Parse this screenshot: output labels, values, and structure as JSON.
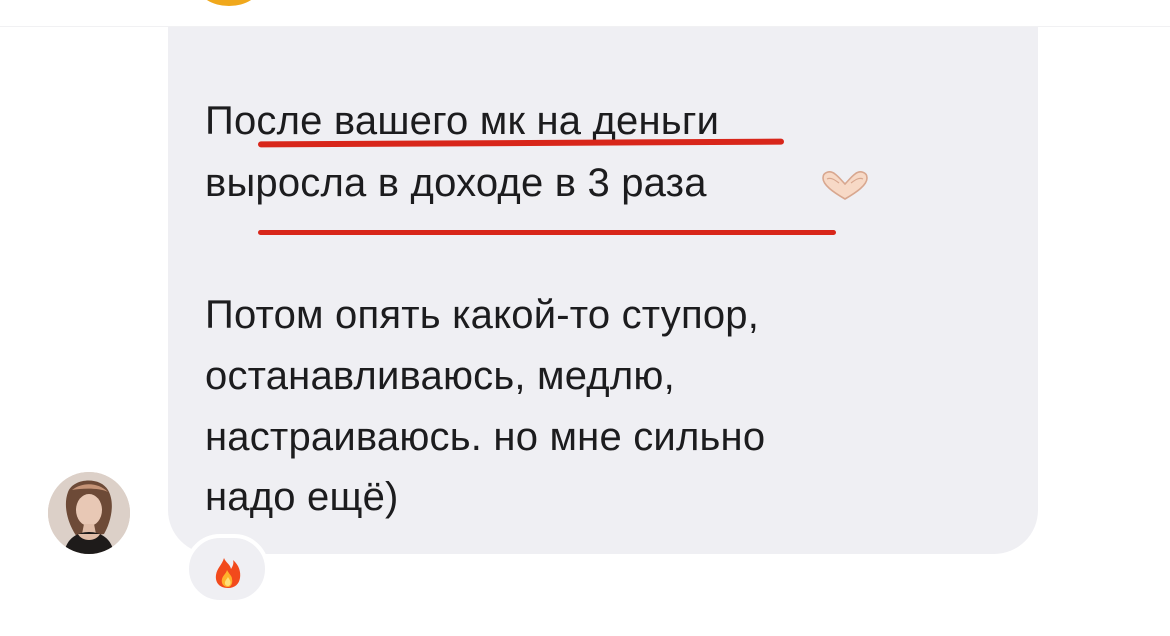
{
  "message": {
    "lines": [
      "После вашего мк на деньги",
      "выросла в доходе в 3 раза",
      "Потом опять какой-то ступор,",
      "останавливаюсь, медлю,",
      "настраиваюсь. но мне сильно",
      "надо ещё)"
    ],
    "underline_color": "#d8261a",
    "bubble_color": "#efeff3"
  },
  "icons": {
    "trailing_emoji": "heart-hands-icon",
    "reaction": "fire-icon",
    "avatar": "avatar-icon"
  },
  "colors": {
    "text": "#1c1c1e",
    "background": "#ffffff",
    "top_avatar": "#f0a81c"
  }
}
